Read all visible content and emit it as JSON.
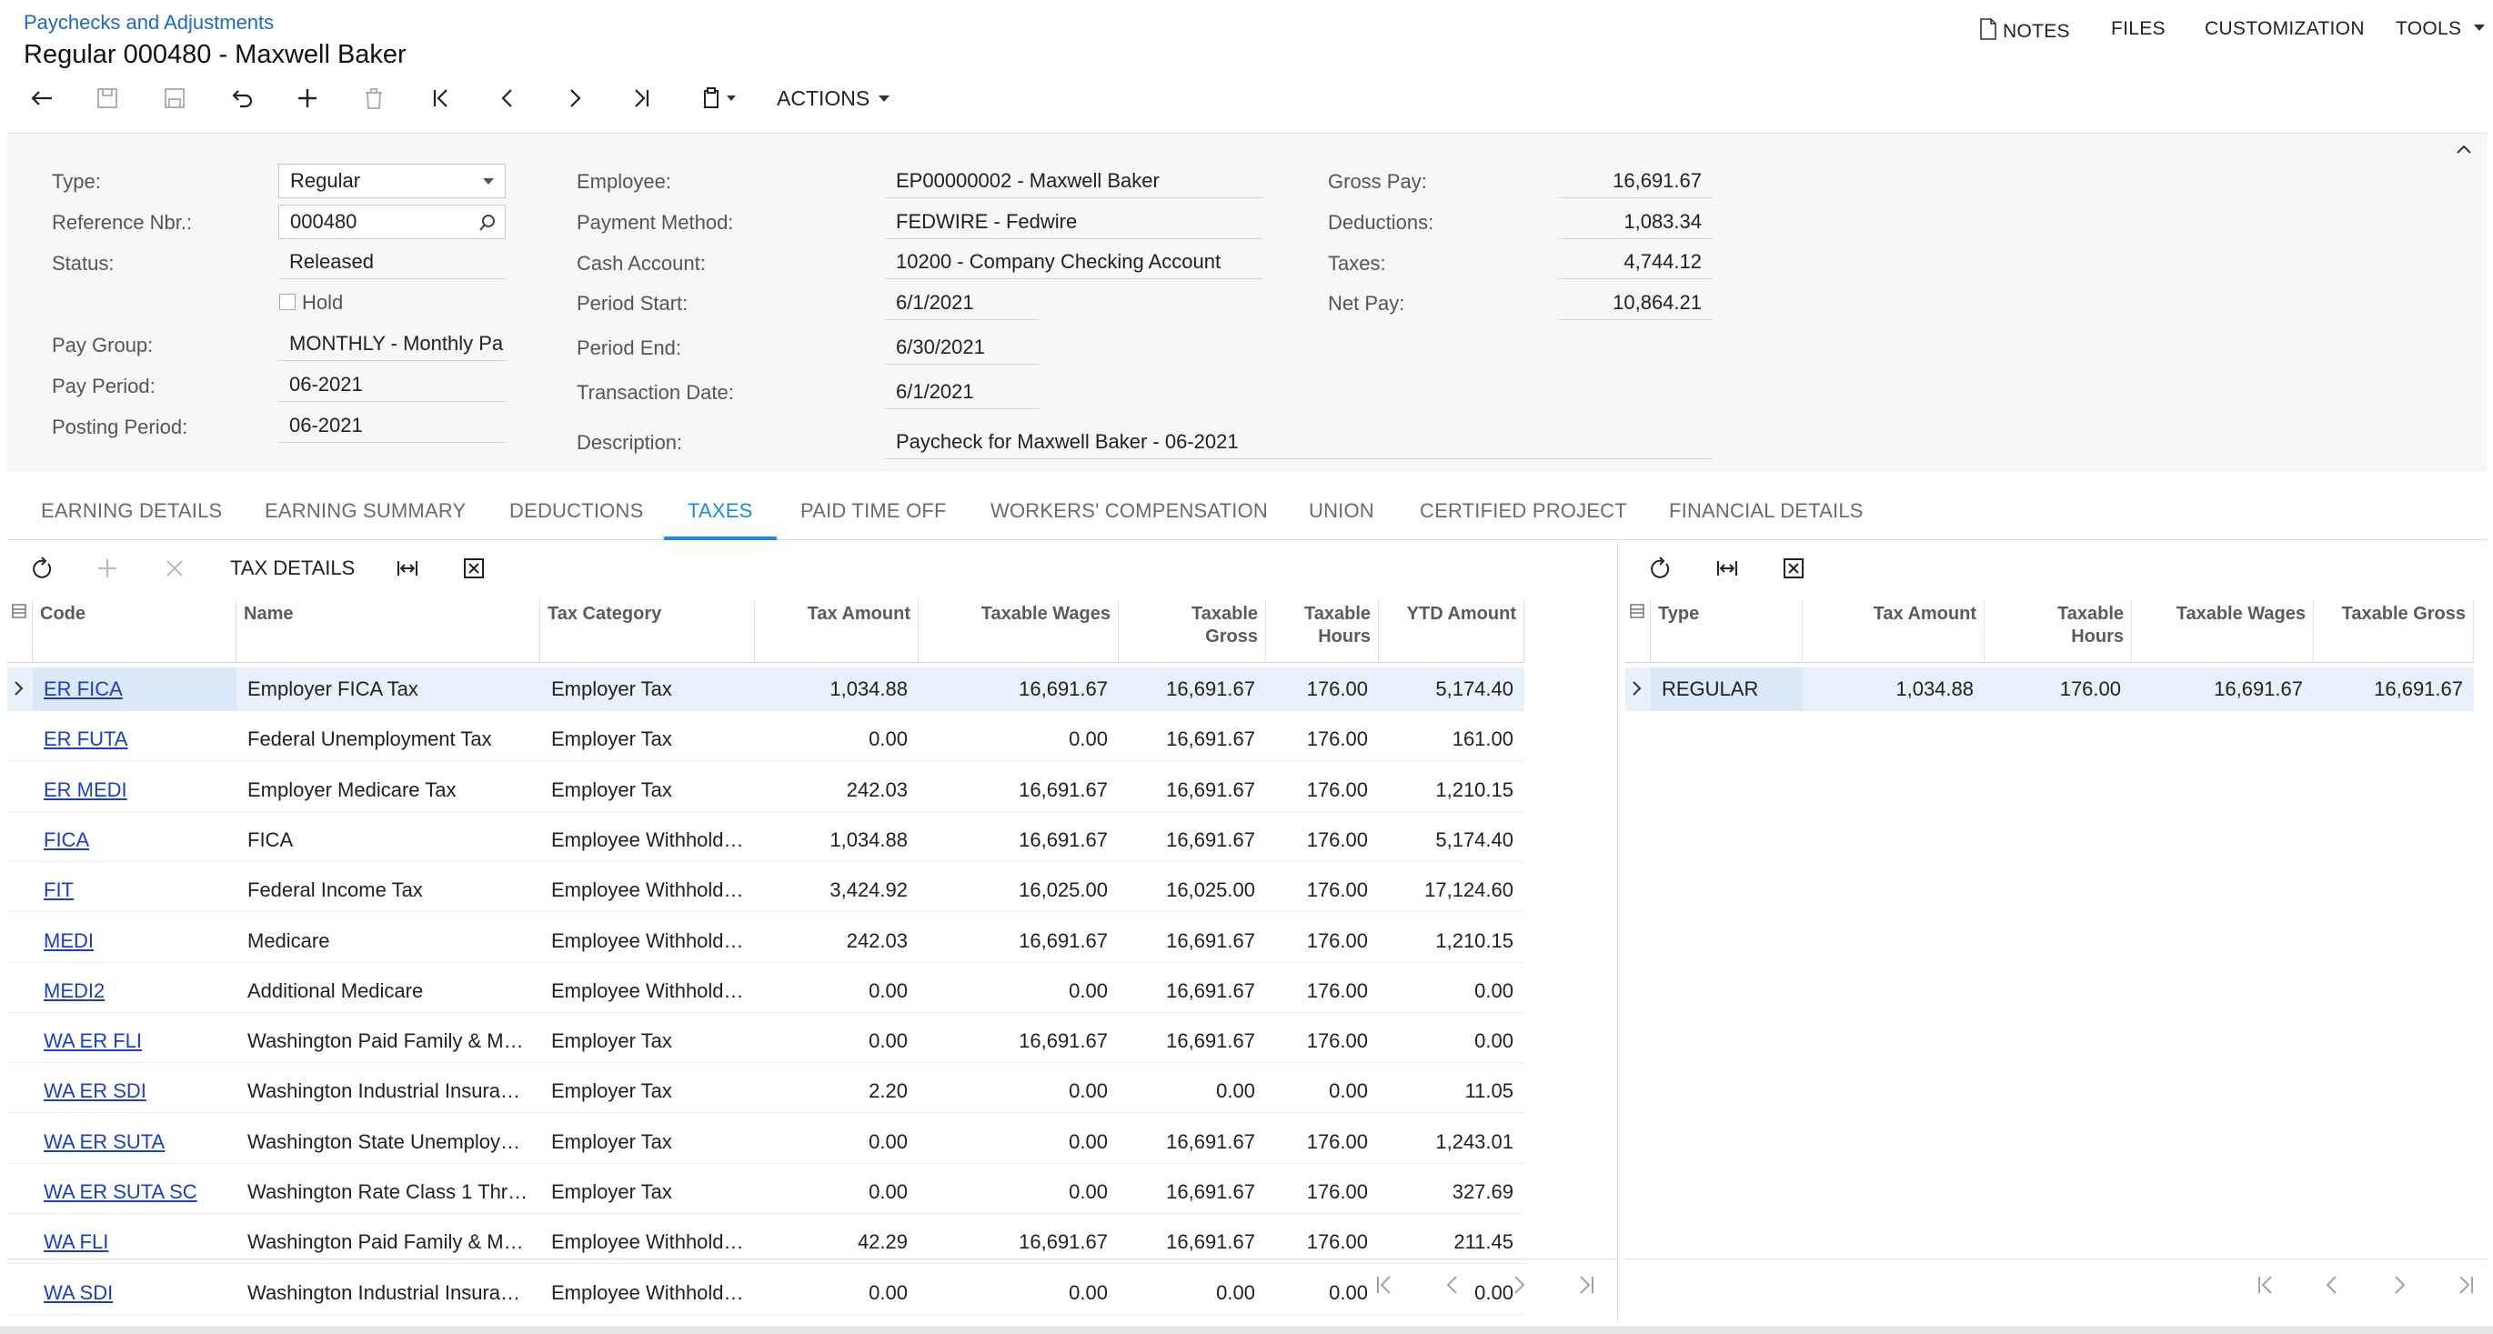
{
  "header": {
    "breadcrumb": "Paychecks and Adjustments",
    "title": "Regular 000480 - Maxwell Baker",
    "notes": "NOTES",
    "files": "FILES",
    "customization": "CUSTOMIZATION",
    "tools": "TOOLS",
    "actions": "ACTIONS"
  },
  "form": {
    "type_label": "Type:",
    "type_value": "Regular",
    "ref_label": "Reference Nbr.:",
    "ref_value": "000480",
    "status_label": "Status:",
    "status_value": "Released",
    "hold_label": "Hold",
    "paygroup_label": "Pay Group:",
    "paygroup_value": "MONTHLY - Monthly Pa",
    "payperiod_label": "Pay Period:",
    "payperiod_value": "06-2021",
    "postingperiod_label": "Posting Period:",
    "postingperiod_value": "06-2021",
    "employee_label": "Employee:",
    "employee_value": "EP00000002 - Maxwell Baker",
    "paymethod_label": "Payment Method:",
    "paymethod_value": "FEDWIRE - Fedwire",
    "cashacct_label": "Cash Account:",
    "cashacct_value": "10200 - Company Checking Account",
    "periodstart_label": "Period Start:",
    "periodstart_value": "6/1/2021",
    "periodend_label": "Period End:",
    "periodend_value": "6/30/2021",
    "trandate_label": "Transaction Date:",
    "trandate_value": "6/1/2021",
    "desc_label": "Description:",
    "desc_value": "Paycheck for Maxwell Baker - 06-2021",
    "gross_label": "Gross Pay:",
    "gross_value": "16,691.67",
    "deductions_label": "Deductions:",
    "deductions_value": "1,083.34",
    "taxes_label": "Taxes:",
    "taxes_value": "4,744.12",
    "netpay_label": "Net Pay:",
    "netpay_value": "10,864.21"
  },
  "tabs": [
    "EARNING DETAILS",
    "EARNING SUMMARY",
    "DEDUCTIONS",
    "TAXES",
    "PAID TIME OFF",
    "WORKERS' COMPENSATION",
    "UNION",
    "CERTIFIED PROJECT",
    "FINANCIAL DETAILS"
  ],
  "left_grid": {
    "toolbar_text": "TAX DETAILS",
    "headers": {
      "code": "Code",
      "name": "Name",
      "category": "Tax Category",
      "amount": "Tax Amount",
      "wages": "Taxable Wages",
      "gross1": "Taxable",
      "gross2": "Gross",
      "hours1": "Taxable",
      "hours2": "Hours",
      "ytd": "YTD Amount"
    },
    "rows": [
      [
        "ER FICA",
        "Employer FICA Tax",
        "Employer Tax",
        "1,034.88",
        "16,691.67",
        "16,691.67",
        "176.00",
        "5,174.40"
      ],
      [
        "ER FUTA",
        "Federal Unemployment Tax",
        "Employer Tax",
        "0.00",
        "0.00",
        "16,691.67",
        "176.00",
        "161.00"
      ],
      [
        "ER MEDI",
        "Employer Medicare Tax",
        "Employer Tax",
        "242.03",
        "16,691.67",
        "16,691.67",
        "176.00",
        "1,210.15"
      ],
      [
        "FICA",
        "FICA",
        "Employee Withhold…",
        "1,034.88",
        "16,691.67",
        "16,691.67",
        "176.00",
        "5,174.40"
      ],
      [
        "FIT",
        "Federal Income Tax",
        "Employee Withhold…",
        "3,424.92",
        "16,025.00",
        "16,025.00",
        "176.00",
        "17,124.60"
      ],
      [
        "MEDI",
        "Medicare",
        "Employee Withhold…",
        "242.03",
        "16,691.67",
        "16,691.67",
        "176.00",
        "1,210.15"
      ],
      [
        "MEDI2",
        "Additional Medicare",
        "Employee Withhold…",
        "0.00",
        "0.00",
        "16,691.67",
        "176.00",
        "0.00"
      ],
      [
        "WA ER FLI",
        "Washington Paid Family & M…",
        "Employer Tax",
        "0.00",
        "16,691.67",
        "16,691.67",
        "176.00",
        "0.00"
      ],
      [
        "WA ER SDI",
        "Washington Industrial Insura…",
        "Employer Tax",
        "2.20",
        "0.00",
        "0.00",
        "0.00",
        "11.05"
      ],
      [
        "WA ER SUTA",
        "Washington State Unemploy…",
        "Employer Tax",
        "0.00",
        "0.00",
        "16,691.67",
        "176.00",
        "1,243.01"
      ],
      [
        "WA ER SUTA SC",
        "Washington Rate Class 1 Thr…",
        "Employer Tax",
        "0.00",
        "0.00",
        "16,691.67",
        "176.00",
        "327.69"
      ],
      [
        "WA FLI",
        "Washington Paid Family & M…",
        "Employee Withhold…",
        "42.29",
        "16,691.67",
        "16,691.67",
        "176.00",
        "211.45"
      ],
      [
        "WA SDI",
        "Washington Industrial Insura…",
        "Employee Withhold…",
        "0.00",
        "0.00",
        "0.00",
        "0.00",
        "0.00"
      ]
    ]
  },
  "right_grid": {
    "headers": {
      "type": "Type",
      "amount": "Tax Amount",
      "hours1": "Taxable",
      "hours2": "Hours",
      "wages": "Taxable Wages",
      "gross": "Taxable Gross"
    },
    "rows": [
      [
        "REGULAR",
        "1,034.88",
        "176.00",
        "16,691.67",
        "16,691.67"
      ]
    ]
  },
  "colors": {
    "accent": "#1e88e5",
    "link": "#1a3fc7",
    "selected_row": "#e8f1fb"
  },
  "icons": [
    "back-icon",
    "save-close-icon",
    "save-icon",
    "undo-icon",
    "add-icon",
    "delete-icon",
    "first-icon",
    "prev-icon",
    "next-icon",
    "last-icon",
    "clipboard-icon",
    "document-icon",
    "refresh-icon",
    "fit-width-icon",
    "excel-icon",
    "chevron-up-icon",
    "row-arrow-icon"
  ]
}
